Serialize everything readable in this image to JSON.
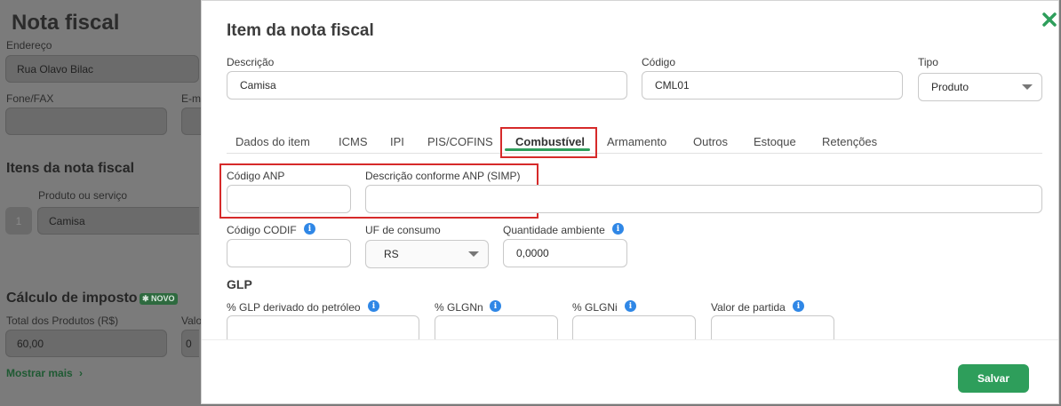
{
  "background": {
    "title": "Nota fiscal",
    "endereco_label": "Endereço",
    "endereco_value": "Rua Olavo Bilac",
    "fone_label": "Fone/FAX",
    "email_label": "E-m",
    "itens_heading": "Itens da nota fiscal",
    "produto_label": "Produto ou serviço",
    "item_number": "1",
    "item_value": "Camisa",
    "calculo_heading": "Cálculo de imposto",
    "novo_badge": "NOVO",
    "total_label": "Total dos Produtos (R$)",
    "valor_label": "Valo",
    "total_value": "60,00",
    "other_value": "0",
    "mostrar_mais": "Mostrar mais"
  },
  "modal": {
    "title": "Item da nota fiscal",
    "descricao_label": "Descrição",
    "descricao_value": "Camisa",
    "codigo_label": "Código",
    "codigo_value": "CML01",
    "tipo_label": "Tipo",
    "tipo_value": "Produto",
    "tabs": [
      {
        "label": "Dados do item"
      },
      {
        "label": "ICMS"
      },
      {
        "label": "IPI"
      },
      {
        "label": "PIS/COFINS"
      },
      {
        "label": "Combustível"
      },
      {
        "label": "Armamento"
      },
      {
        "label": "Outros"
      },
      {
        "label": "Estoque"
      },
      {
        "label": "Retenções"
      }
    ],
    "active_tab": "Combustível",
    "codigo_anp_label": "Código ANP",
    "codigo_anp_value": "",
    "descricao_anp_label": "Descrição conforme ANP (SIMP)",
    "descricao_anp_value": "",
    "codigo_codif_label": "Código CODIF",
    "uf_label": "UF de consumo",
    "uf_value": "RS",
    "quantidade_label": "Quantidade ambiente",
    "quantidade_value": "0,0000",
    "glp_heading": "GLP",
    "glp_derivado_label": "% GLP derivado do petróleo",
    "glgnn_label": "% GLGNn",
    "glgni_label": "% GLGNi",
    "valor_partida_label": "Valor de partida",
    "save_label": "Salvar",
    "info_glyph": "i"
  },
  "colors": {
    "accent": "#2e9e5b",
    "highlight": "#d62a2a",
    "info": "#2f87e6"
  }
}
